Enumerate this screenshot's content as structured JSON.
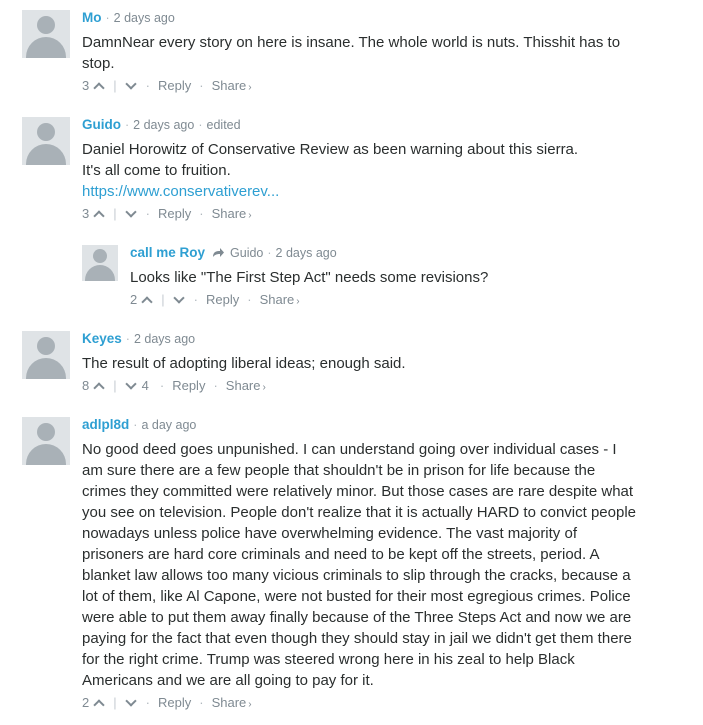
{
  "comments": [
    {
      "author": "Mo",
      "time": "2 days ago",
      "lines": [
        "DamnNear every story on here is insane. The whole world is nuts. Thisshit has to",
        "stop."
      ],
      "upvotes": "3",
      "downvotes": "",
      "reply_label": "Reply",
      "share_label": "Share",
      "share_chevron": "›"
    },
    {
      "author": "Guido",
      "time": "2 days ago",
      "edited_label": "edited",
      "lines": [
        "Daniel Horowitz of Conservative Review as been warning about this sierra.",
        "It's all come to fruition."
      ],
      "link_text": "https://www.conservativerev...",
      "upvotes": "3",
      "downvotes": "",
      "reply_label": "Reply",
      "share_label": "Share",
      "share_chevron": "›"
    },
    {
      "author": "call me Roy",
      "reply_to_icon": "reply-arrow-icon",
      "parent_author": "Guido",
      "time": "2 days ago",
      "lines": [
        "Looks like \"The First Step Act\" needs some revisions?"
      ],
      "upvotes": "2",
      "downvotes": "",
      "reply_label": "Reply",
      "share_label": "Share",
      "share_chevron": "›"
    },
    {
      "author": "Keyes",
      "time": "2 days ago",
      "lines": [
        "The result of adopting liberal ideas; enough said."
      ],
      "upvotes": "8",
      "downvotes": "4",
      "reply_label": "Reply",
      "share_label": "Share",
      "share_chevron": "›"
    },
    {
      "author": "adlpl8d",
      "time": "a day ago",
      "lines": [
        "No good deed goes unpunished. I can understand going over individual cases - I",
        "am sure there are a few people that shouldn't be in prison for life because the",
        "crimes they committed were relatively minor. But those cases are rare despite what",
        "you see on television. People don't realize that it is actually HARD to convict people",
        "nowadays unless police have overwhelming evidence. The vast majority of",
        "prisoners are hard core criminals and need to be kept off the streets, period. A",
        "blanket law allows too many vicious criminals to slip through the cracks, because a",
        "lot of them, like Al Capone, were not busted for their most egregious crimes. Police",
        "were able to put them away finally because of the Three Steps Act and now we are",
        "paying for the fact that even though they should stay in jail we didn't get them there",
        "for the right crime. Trump was steered wrong here in his zeal to help Black",
        "Americans and we are all going to pay for it."
      ],
      "upvotes": "2",
      "downvotes": "",
      "reply_label": "Reply",
      "share_label": "Share",
      "share_chevron": "›"
    }
  ],
  "colors": {
    "author": "#2e9fd2",
    "meta": "#7f8a92",
    "text": "#2a2e2e",
    "avatar_bg": "#dfe3e6"
  }
}
